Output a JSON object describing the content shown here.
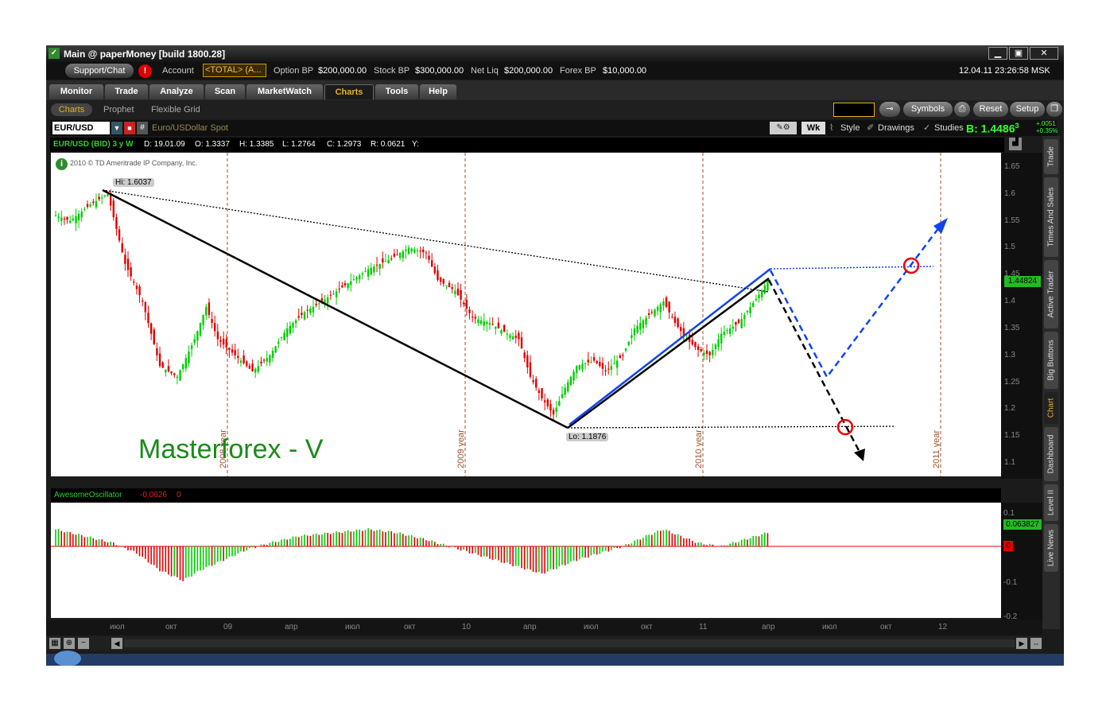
{
  "window": {
    "title": "Main @ paperMoney [build 1800.28]"
  },
  "account": {
    "support": "Support/Chat",
    "account_label": "Account",
    "account_value": "<TOTAL> (A...",
    "option_bp_label": "Option BP",
    "option_bp": "$200,000.00",
    "stock_bp_label": "Stock BP",
    "stock_bp": "$300,000.00",
    "netliq_label": "Net Liq",
    "netliq": "$200,000.00",
    "forex_bp_label": "Forex BP",
    "forex_bp": "$10,000.00",
    "datetime": "12.04.11 23:26:58 MSK"
  },
  "tabs": [
    "Monitor",
    "Trade",
    "Analyze",
    "Scan",
    "MarketWatch",
    "Charts",
    "Tools",
    "Help"
  ],
  "subtabs": [
    "Charts",
    "Prophet",
    "Flexible Grid"
  ],
  "right_buttons": {
    "symbols": "Symbols",
    "reset": "Reset",
    "setup": "Setup"
  },
  "symbol": {
    "code": "EUR/USD",
    "desc": "Euro/USDollar Spot",
    "period": "Wk",
    "style": "Style",
    "drawings": "Drawings",
    "studies": "Studies",
    "bid": "B: 1.4486",
    "bid_sup": "3",
    "chg1": "+.0051",
    "chg2": "+0.35%"
  },
  "info": {
    "label": "EUR/USD (BID) 3 y W",
    "d": "D: 19.01.09",
    "o": "O: 1.3337",
    "h": "H: 1.3385",
    "l": "L: 1.2764",
    "c": "C: 1.2973",
    "r": "R: 0.0621",
    "y": "Y:"
  },
  "copyright": "2010 © TD Ameritrade IP Company, Inc.",
  "chart": {
    "hi_label": "Hi: 1.6037",
    "lo_label": "Lo: 1.1876",
    "watermark": "Masterforex - V",
    "price_tag": "1.44824",
    "price_ticks": [
      "1.65",
      "1.6",
      "1.55",
      "1.5",
      "1.45",
      "1.4",
      "1.35",
      "1.3",
      "1.25",
      "1.2",
      "1.15",
      "1.1"
    ],
    "year_labels": [
      "2008 year",
      "2009 year",
      "2010 year",
      "2011 year"
    ]
  },
  "oscillator": {
    "name": "AwesomeOscillator",
    "value": "-0.0626",
    "zero": "0",
    "tag": "0.063827",
    "zero_tag": "0",
    "ticks": [
      "0.1",
      "0",
      "-0.1",
      "-0.2"
    ]
  },
  "xaxis": [
    "июл",
    "окт",
    "09",
    "апр",
    "июл",
    "окт",
    "10",
    "апр",
    "июл",
    "окт",
    "11",
    "апр",
    "июл",
    "окт",
    "12"
  ],
  "sidetabs": [
    "Trade",
    "Times And Sales",
    "Active Trader",
    "Big Buttons",
    "Chart",
    "Dashboard",
    "Level II",
    "Live News"
  ],
  "colors": {
    "up": "#00cc00",
    "down": "#dd0000",
    "accent": "#e6b020",
    "watermark": "#1a8a1a",
    "bid": "#33ff33"
  }
}
